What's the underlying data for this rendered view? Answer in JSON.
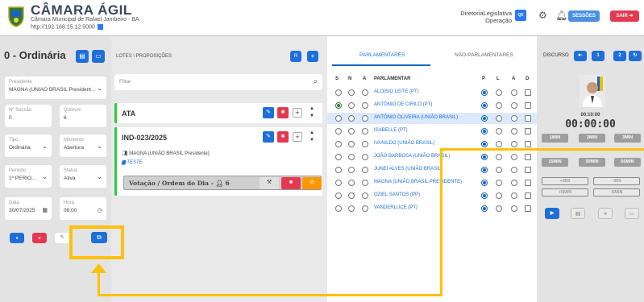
{
  "header": {
    "app_title": "CÂMARA ÁGIL",
    "subtitle": "Câmara Municipal de Rafael Jambeiro - BA",
    "url": "http://192.168.15.12:5000",
    "user_name": "DiretoriaLegislativa",
    "user_role": "Operação",
    "avatar_initials": "Q0",
    "sessions_label": "SESSÕES",
    "exit_label": "SAIR"
  },
  "session": {
    "title": "0 - Ordinária",
    "fields": [
      {
        "label": "Presidente",
        "value": "MAGNA (UNIÃO BRASIL President..."
      },
      {
        "label": "Nº Sessão",
        "value": "0"
      },
      {
        "label": "Quórum",
        "value": "6"
      },
      {
        "label": "Tipo",
        "value": "Ordinária"
      },
      {
        "label": "Momento",
        "value": "Abertura"
      },
      {
        "label": "Período",
        "value": "1º PERÍO..."
      },
      {
        "label": "Status",
        "value": "Ativa"
      },
      {
        "label": "Data",
        "value": "30/07/2025"
      },
      {
        "label": "Hora",
        "value": "08:00"
      }
    ]
  },
  "proposicoes": {
    "breadcrumb": "LOTES \\ PROPOSIÇÕES",
    "filter_placeholder": "Filtar",
    "ata_title": "ATA",
    "item_title": "IND-023/2025",
    "author": "MAGNA (UNIÃO BRASIL Presidente)",
    "doc_label": "TESTE",
    "vote_label": "Votação / Ordem do Dia -",
    "vote_count": "6"
  },
  "parlamentares": {
    "tab_active": "PARLAMENTARES",
    "tab_other": "NÃO-PARLAMENTARES",
    "col_s": "S",
    "col_n": "N",
    "col_a": "A",
    "col_name": "PARLAMENTAR",
    "col_p": "P",
    "col_l": "L",
    "col_a2": "A",
    "col_d": "D",
    "rows": [
      {
        "name": "ALOISIO LEITE (PT)"
      },
      {
        "name": "ANTÔNIO DE CIRILO (PT)"
      },
      {
        "name": "ANTÔNIO OLIVEIRA (UNIÃO BRASIL)"
      },
      {
        "name": "ISABELLE (PT)"
      },
      {
        "name": "IVANILDO (UNIÃO BRASIL)"
      },
      {
        "name": "JOÃO BARBOSA (UNIÃO BRASIL)"
      },
      {
        "name": "JUNEI ALVES (UNIÃO BRASIL)"
      },
      {
        "name": "MAGNA (UNIÃO BRASIL PRESIDENTE)"
      },
      {
        "name": "OZIEL SANTOS (PP)"
      },
      {
        "name": "VANDERLUCE (PT)"
      }
    ]
  },
  "discurso": {
    "label": "DISCURSO",
    "btn1": "1",
    "btn2": "2",
    "small_timer": "00:10:00",
    "main_timer": "00:00:00",
    "presets": [
      "1MIN",
      "2MIN",
      "3MIN",
      "15MIN",
      "30MIN",
      "60MIN"
    ],
    "adjust": [
      "+30S",
      "-30S",
      "+5MIN",
      "-5MIN"
    ]
  },
  "colors": {
    "primary": "#1e6fd9",
    "danger": "#e53950",
    "success": "#2ecc40",
    "warning": "#ff9800",
    "highlight": "#ffc107"
  }
}
